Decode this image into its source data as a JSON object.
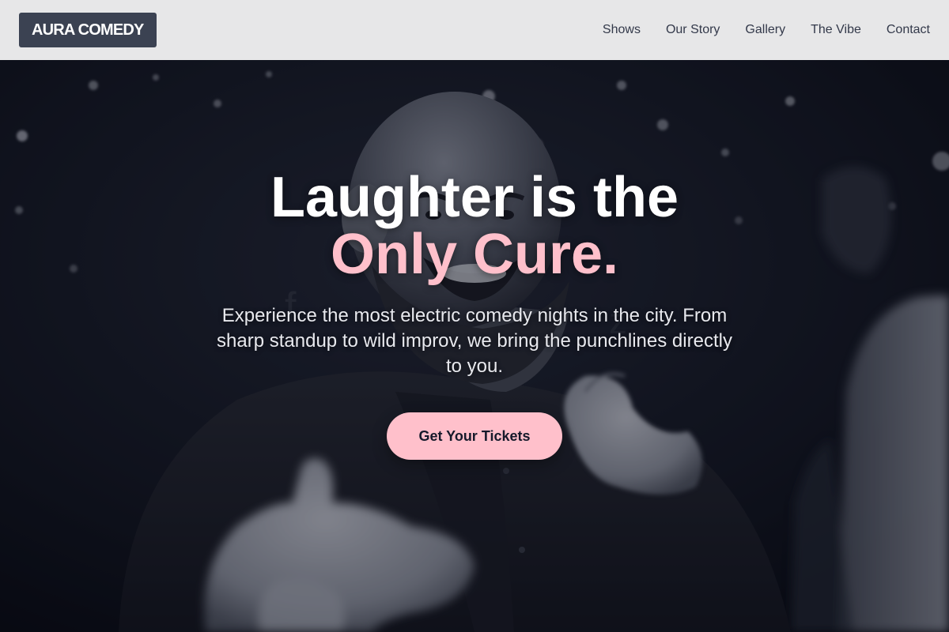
{
  "brand": {
    "logo_text": "AURA COMEDY"
  },
  "nav": {
    "items": [
      {
        "label": "Shows"
      },
      {
        "label": "Our Story"
      },
      {
        "label": "Gallery"
      },
      {
        "label": "The Vibe"
      },
      {
        "label": "Contact"
      }
    ]
  },
  "hero": {
    "title_line1": "Laughter is the",
    "title_line2": "Only Cure.",
    "subtitle": "Experience the most electric comedy nights in the city. From sharp standup to wild improv, we bring the punchlines directly to you.",
    "cta_label": "Get Your Tickets"
  },
  "colors": {
    "header_bg": "#e7e7e8",
    "logo_bg": "#3b4252",
    "accent_pink": "#ffc0cb",
    "hero_dark": "#0b0e18",
    "nav_text": "#33394a"
  }
}
